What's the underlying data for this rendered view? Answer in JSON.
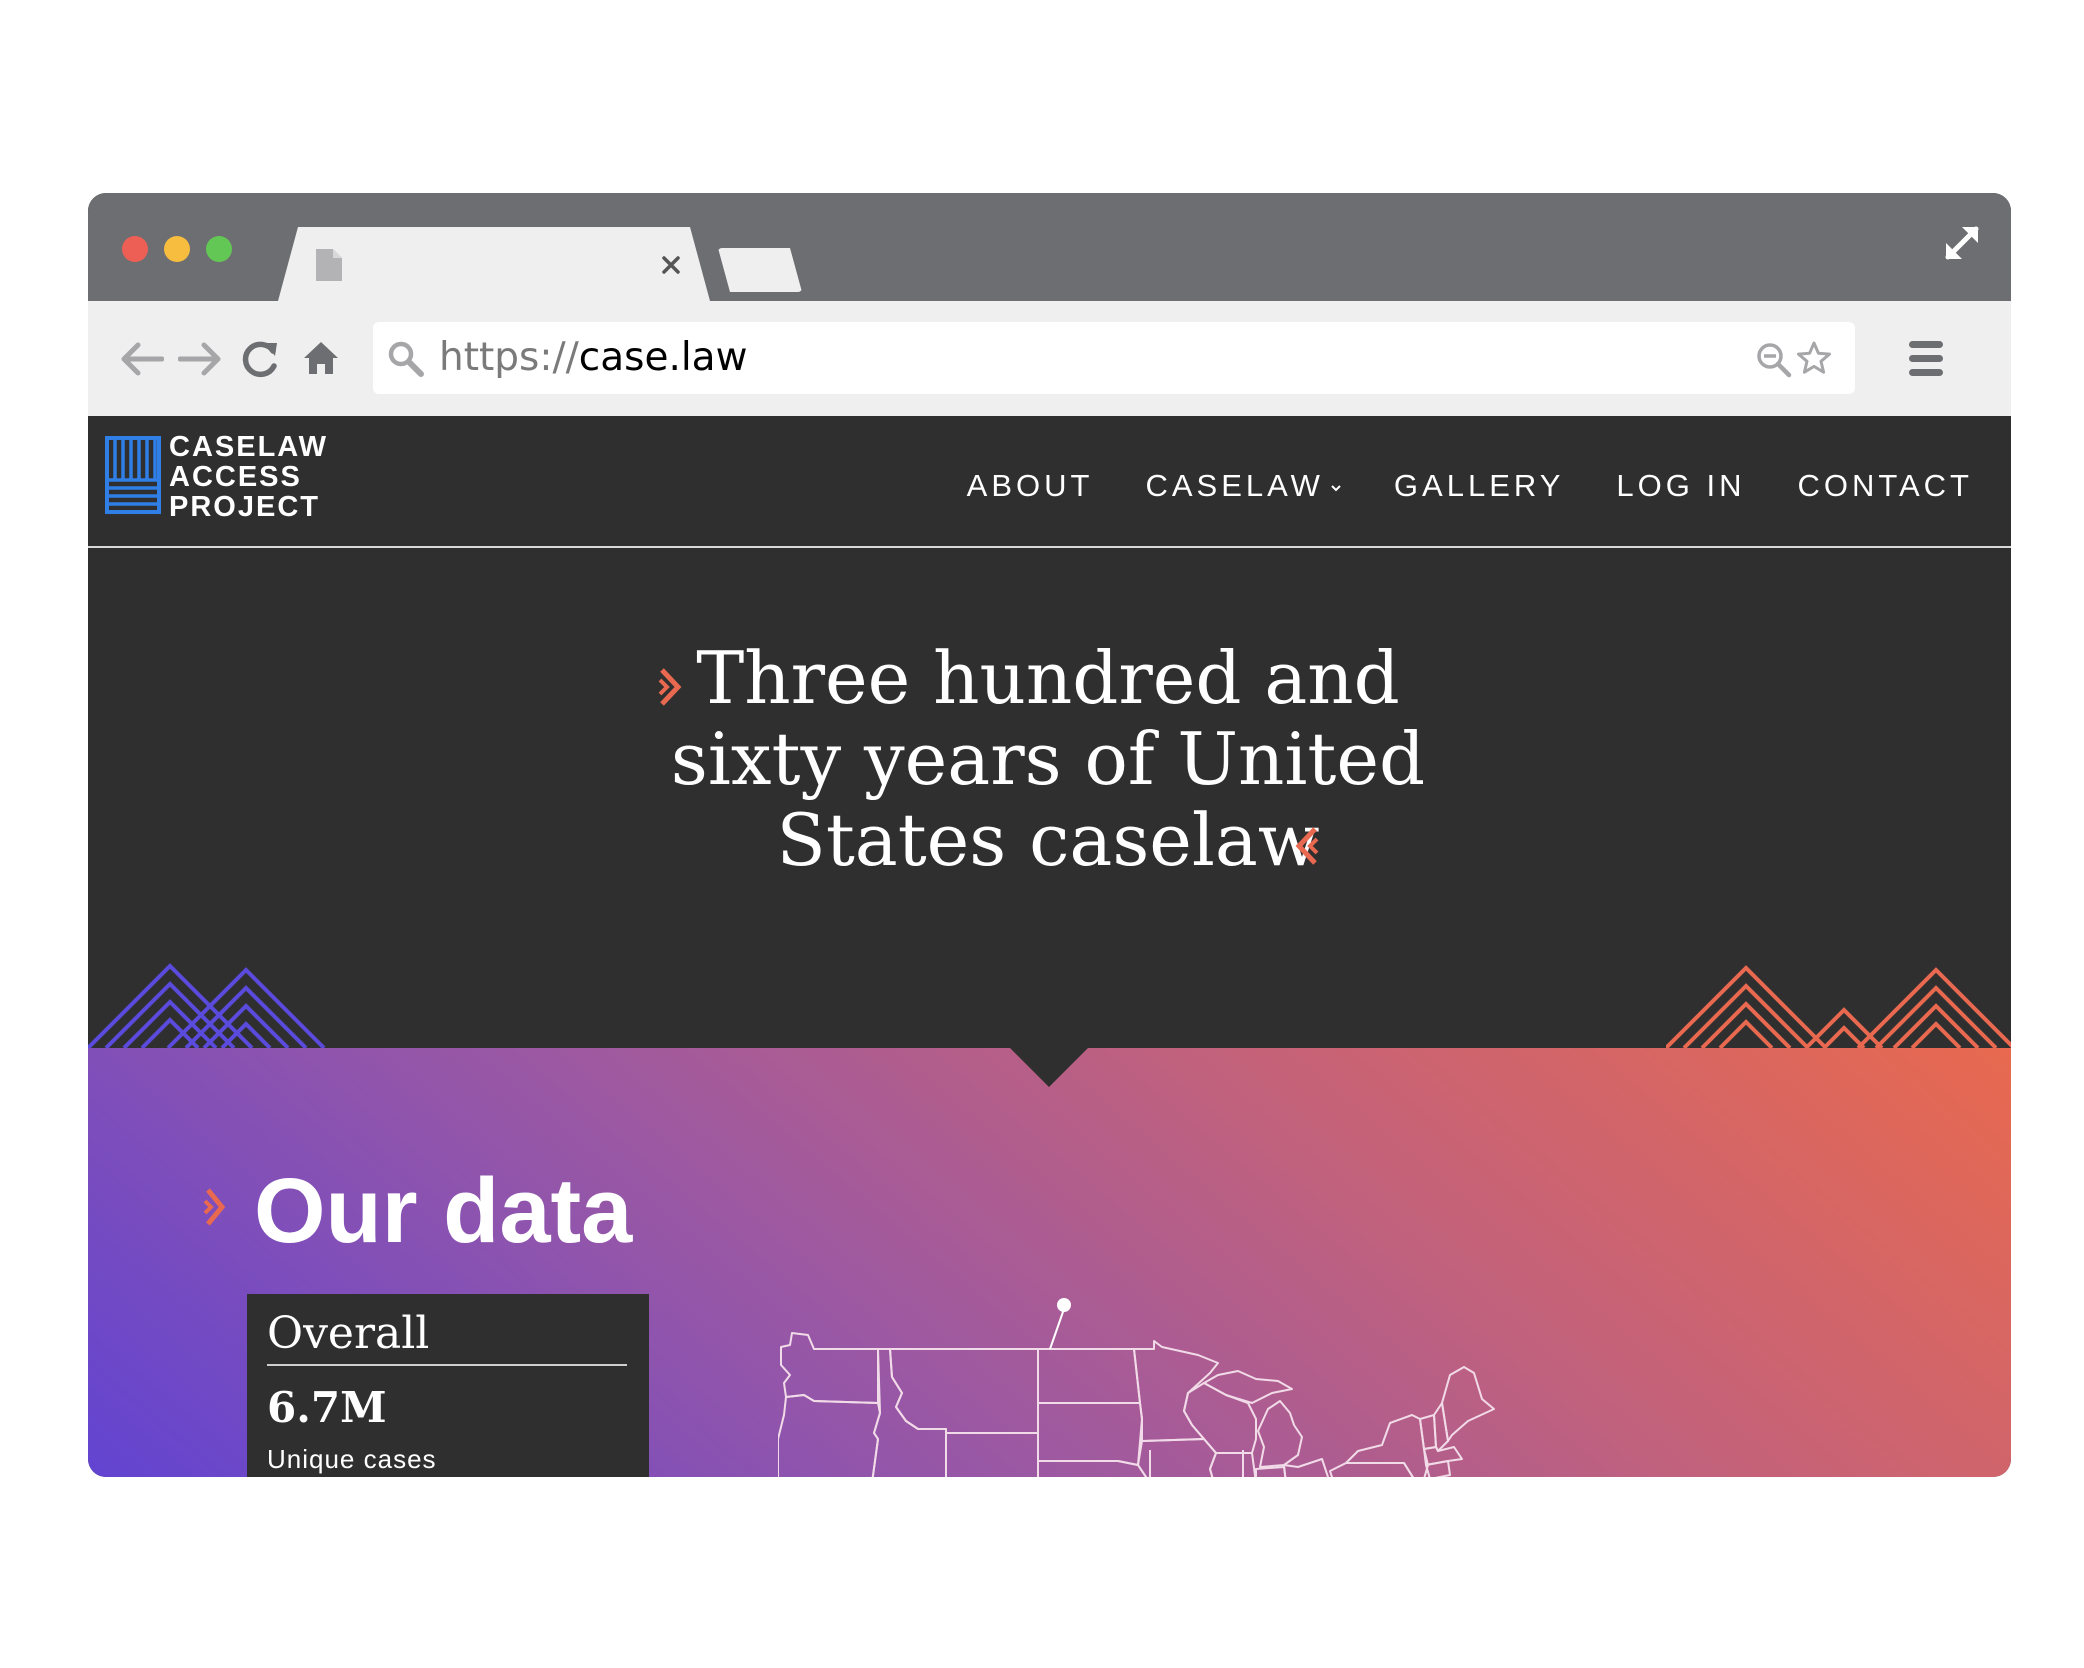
{
  "browser": {
    "url_protocol": "https://",
    "url_host": "case.law",
    "window_dots": [
      "#ed5f55",
      "#f7bd3f",
      "#63c755"
    ]
  },
  "site": {
    "logo_lines": [
      "CASELAW",
      "ACCESS",
      "PROJECT"
    ],
    "logo_color": "#2f7fe6",
    "nav": [
      {
        "label": "ABOUT"
      },
      {
        "label": "CASELAW",
        "has_dropdown": true
      },
      {
        "label": "GALLERY"
      },
      {
        "label": "LOG IN"
      },
      {
        "label": "CONTACT"
      }
    ]
  },
  "hero": {
    "headline_lines": [
      "Three hundred and",
      "sixty years of United",
      "States caselaw"
    ],
    "accent_color": "#e8694f"
  },
  "data_section": {
    "heading": "Our data",
    "card": {
      "title": "Overall",
      "value": "6.7M",
      "label": "Unique cases"
    }
  }
}
